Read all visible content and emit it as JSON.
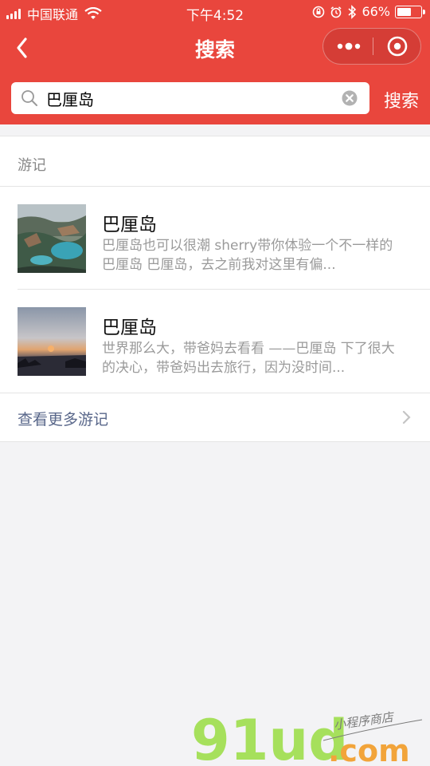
{
  "status_bar": {
    "carrier": "中国联通",
    "time": "下午4:52",
    "battery": "66%",
    "battery_level": 0.66
  },
  "nav": {
    "title": "搜索",
    "back_icon": "chevron-left-icon",
    "more_icon": "more-dots-icon",
    "close_icon": "target-circle-icon"
  },
  "search": {
    "value": "巴厘岛",
    "button_label": "搜索"
  },
  "results": {
    "section_title": "游记",
    "items": [
      {
        "title": "巴厘岛",
        "desc": "巴厘岛也可以很潮 sherry带你体验一个不一样的巴厘岛 巴厘岛，去之前我对这里有偏..."
      },
      {
        "title": "巴厘岛",
        "desc": "世界那么大，带爸妈去看看 ——巴厘岛 下了很大的决心，带爸妈出去旅行，因为没时间..."
      }
    ],
    "more_label": "查看更多游记"
  },
  "watermark": {
    "logo": "91ud",
    "dotcom": ".com",
    "tagline": "小程序商店"
  },
  "colors": {
    "accent": "#e9463d",
    "link": "#59678a"
  }
}
